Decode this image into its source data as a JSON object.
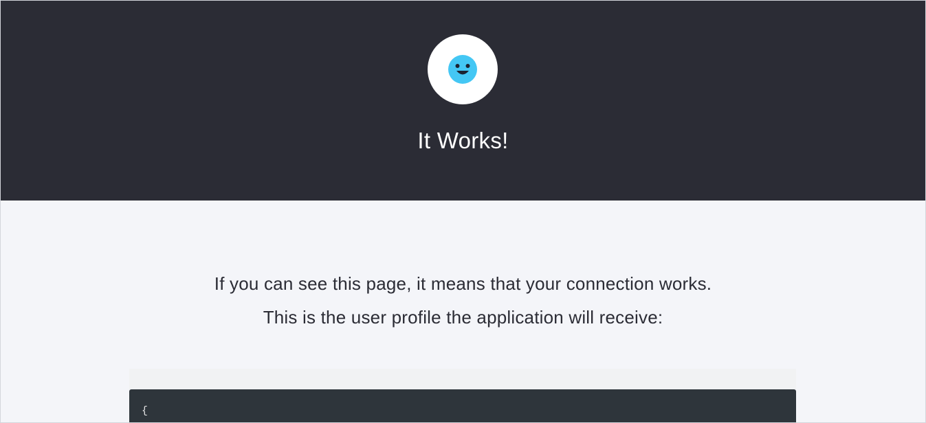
{
  "hero": {
    "logo_icon": "smiley-face-icon",
    "title": "It Works!"
  },
  "message": {
    "line1": "If you can see this page, it means that your connection works.",
    "line2": "This is the user profile the application will receive:"
  },
  "code": {
    "first_line": "{"
  },
  "colors": {
    "hero_bg": "#2b2c35",
    "page_bg": "#f4f5f9",
    "smiley": "#44c7f4",
    "code_bg": "#2e353b"
  }
}
